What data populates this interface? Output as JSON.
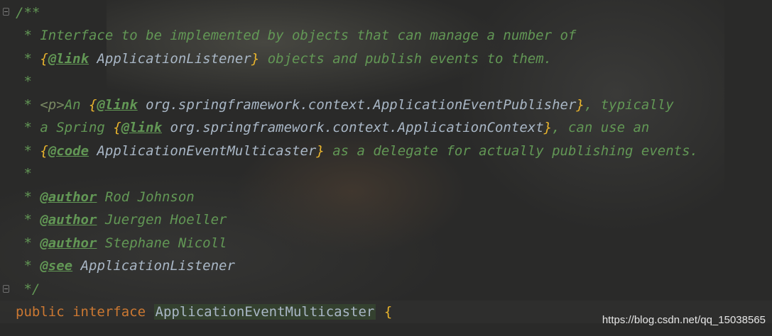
{
  "colors": {
    "background": "#2a2a29",
    "comment": "#629755",
    "brace": "#e8b42d",
    "keyword": "#cc7832",
    "identifier": "#a9b7c6"
  },
  "gutter": {
    "fold_icons": [
      "fold-open-icon",
      "fold-close-icon"
    ]
  },
  "code": {
    "open": "/**",
    "star": "*",
    "close": "*/",
    "l2": "Interface to be implemented by objects that can manage a number of",
    "l3": {
      "open_brace": "{",
      "tag": "@link",
      "ref": "ApplicationListener",
      "close_brace": "}",
      "rest": "objects and publish events to them."
    },
    "l5": {
      "html": "<p>",
      "text": "An",
      "open_brace": "{",
      "tag": "@link",
      "ref": "org.springframework.context.ApplicationEventPublisher",
      "close_brace": "}",
      "rest": ", typically"
    },
    "l6": {
      "text": "a Spring",
      "open_brace": "{",
      "tag": "@link",
      "ref": "org.springframework.context.ApplicationContext",
      "close_brace": "}",
      "rest": ", can use an"
    },
    "l7": {
      "open_brace": "{",
      "tag": "@code",
      "ref": "ApplicationEventMulticaster",
      "close_brace": "}",
      "rest": "as a delegate for actually publishing events."
    },
    "authors": [
      {
        "tag": "@author",
        "name": "Rod Johnson"
      },
      {
        "tag": "@author",
        "name": "Juergen Hoeller"
      },
      {
        "tag": "@author",
        "name": "Stephane Nicoll"
      }
    ],
    "see": {
      "tag": "@see",
      "ref": "ApplicationListener"
    },
    "decl": {
      "kw1": "public",
      "kw2": "interface",
      "name": "ApplicationEventMulticaster",
      "brace": "{"
    }
  },
  "watermark": "https://blog.csdn.net/qq_15038565"
}
